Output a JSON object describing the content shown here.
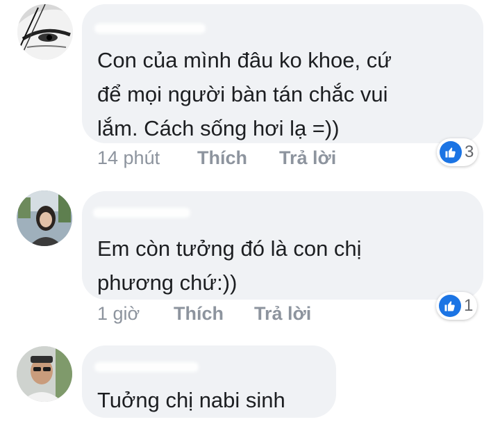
{
  "comments": [
    {
      "text": "Con của mình đâu ko khoe, cứ\nđể mọi người bàn tán chắc vui\nlắm. Cách sống hơi lạ =))",
      "time": "14 phút",
      "like_label": "Thích",
      "reply_label": "Trả lời",
      "reactions": {
        "icon": "like-icon",
        "count": "3"
      }
    },
    {
      "text": "Em còn tưởng đó là con chị\nphương chứ:))",
      "time": "1 giờ",
      "like_label": "Thích",
      "reply_label": "Trả lời",
      "reactions": {
        "icon": "like-icon",
        "count": "1"
      }
    },
    {
      "text": "Tuởng chị nabi sinh"
    }
  ],
  "colors": {
    "bubble": "#f0f2f5",
    "action_text": "#8d949e",
    "like_blue": "#1b74e4"
  }
}
